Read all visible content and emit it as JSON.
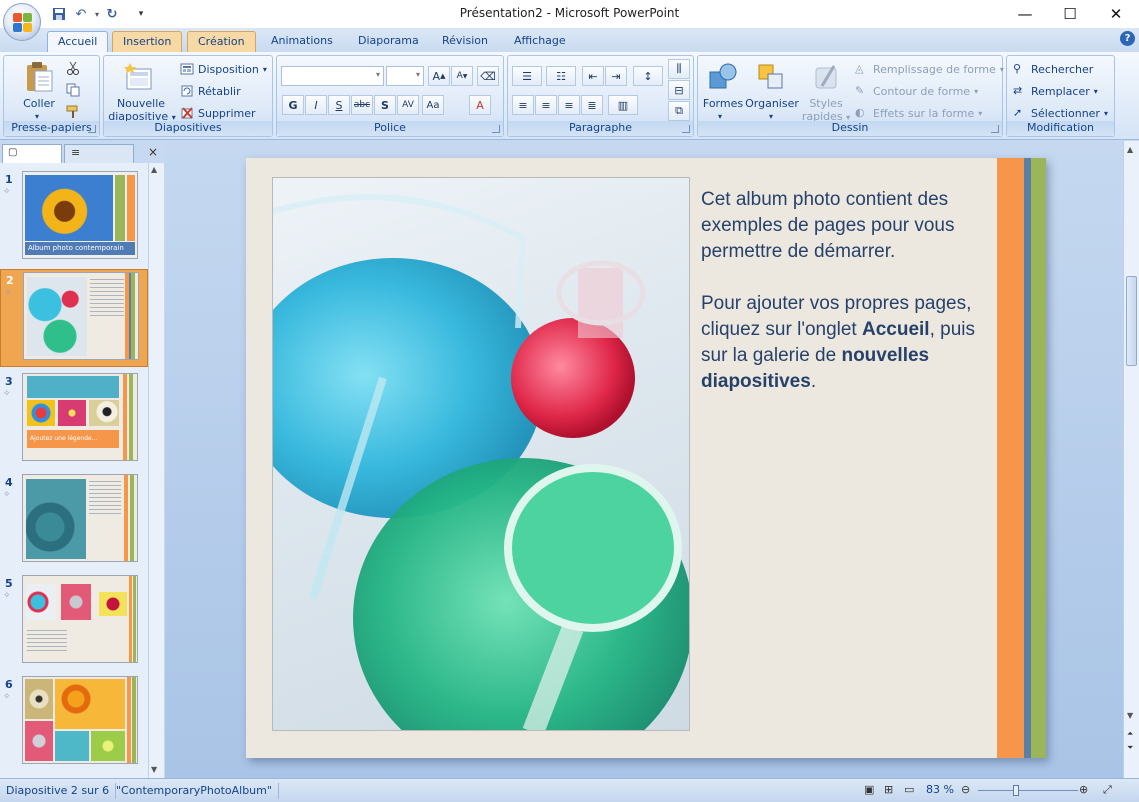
{
  "window": {
    "title": "Présentation2 - Microsoft PowerPoint"
  },
  "tabs": [
    "Accueil",
    "Insertion",
    "Création",
    "Animations",
    "Diaporama",
    "Révision",
    "Affichage"
  ],
  "ribbon": {
    "presse_papiers": {
      "coller": "Coller",
      "label": "Presse-papiers"
    },
    "diapositives": {
      "nouvelle_line1": "Nouvelle",
      "nouvelle_line2": "diapositive",
      "disposition": "Disposition",
      "retablir": "Rétablir",
      "supprimer": "Supprimer",
      "label": "Diapositives"
    },
    "police": {
      "label": "Police",
      "font_value": "",
      "size_value": ""
    },
    "paragraphe": {
      "label": "Paragraphe"
    },
    "dessin": {
      "formes": "Formes",
      "organiser": "Organiser",
      "styles_line1": "Styles",
      "styles_line2": "rapides",
      "remplissage": "Remplissage de forme",
      "contour": "Contour de forme",
      "effets": "Effets sur la forme",
      "label": "Dessin"
    },
    "modification": {
      "rechercher": "Rechercher",
      "remplacer": "Remplacer",
      "selectionner": "Sélectionner",
      "label": "Modification"
    }
  },
  "thumbnails": [
    {
      "num": "1",
      "caption": "Album photo contemporain"
    },
    {
      "num": "2"
    },
    {
      "num": "3",
      "caption": "Ajoutez une légende..."
    },
    {
      "num": "4"
    },
    {
      "num": "5"
    },
    {
      "num": "6"
    }
  ],
  "slide": {
    "para1": "Cet album photo contient des exemples de pages pour vous permettre de démarrer.",
    "para2_a": "Pour ajouter vos propres pages, cliquez sur l'onglet ",
    "para2_b": "Accueil",
    "para2_c": ",  puis sur la galerie de ",
    "para2_d": "nouvelles diapositives",
    "para2_e": "."
  },
  "status": {
    "slide_info": "Diapositive 2 sur 6",
    "theme": "\"ContemporaryPhotoAlbum\"",
    "zoom": "83 %"
  },
  "colors": {
    "accent_orange": "#f5964a",
    "accent_blue": "#5b7fa6",
    "accent_green": "#9bb55a",
    "ribbon_bg": "#dbe7f5"
  }
}
